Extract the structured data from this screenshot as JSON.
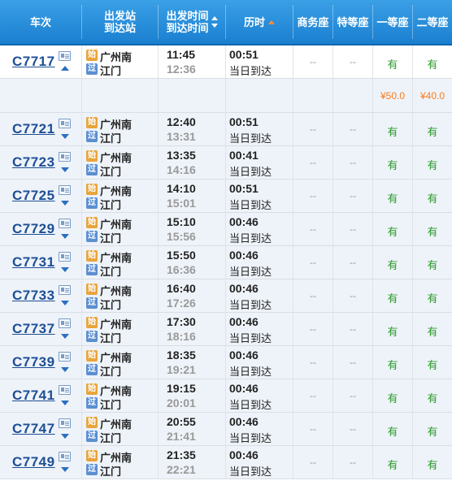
{
  "header": {
    "train": "车次",
    "station_top": "出发站",
    "station_bottom": "到达站",
    "time_top": "出发时间",
    "time_bottom": "到达时间",
    "duration": "历时",
    "business": "商务座",
    "special": "特等座",
    "first": "一等座",
    "second": "二等座"
  },
  "badges": {
    "start": "始",
    "pass": "过"
  },
  "price_row": {
    "first": "¥50.0",
    "second": "¥40.0"
  },
  "trains": [
    {
      "no": "C7717",
      "from": "广州南",
      "to": "江门",
      "dep": "11:45",
      "arr": "12:36",
      "dur": "00:51",
      "day": "当日到达",
      "business": "--",
      "special": "--",
      "first": "有",
      "second": "有"
    },
    {
      "no": "C7721",
      "from": "广州南",
      "to": "江门",
      "dep": "12:40",
      "arr": "13:31",
      "dur": "00:51",
      "day": "当日到达",
      "business": "--",
      "special": "--",
      "first": "有",
      "second": "有"
    },
    {
      "no": "C7723",
      "from": "广州南",
      "to": "江门",
      "dep": "13:35",
      "arr": "14:16",
      "dur": "00:41",
      "day": "当日到达",
      "business": "--",
      "special": "--",
      "first": "有",
      "second": "有"
    },
    {
      "no": "C7725",
      "from": "广州南",
      "to": "江门",
      "dep": "14:10",
      "arr": "15:01",
      "dur": "00:51",
      "day": "当日到达",
      "business": "--",
      "special": "--",
      "first": "有",
      "second": "有"
    },
    {
      "no": "C7729",
      "from": "广州南",
      "to": "江门",
      "dep": "15:10",
      "arr": "15:56",
      "dur": "00:46",
      "day": "当日到达",
      "business": "--",
      "special": "--",
      "first": "有",
      "second": "有"
    },
    {
      "no": "C7731",
      "from": "广州南",
      "to": "江门",
      "dep": "15:50",
      "arr": "16:36",
      "dur": "00:46",
      "day": "当日到达",
      "business": "--",
      "special": "--",
      "first": "有",
      "second": "有"
    },
    {
      "no": "C7733",
      "from": "广州南",
      "to": "江门",
      "dep": "16:40",
      "arr": "17:26",
      "dur": "00:46",
      "day": "当日到达",
      "business": "--",
      "special": "--",
      "first": "有",
      "second": "有"
    },
    {
      "no": "C7737",
      "from": "广州南",
      "to": "江门",
      "dep": "17:30",
      "arr": "18:16",
      "dur": "00:46",
      "day": "当日到达",
      "business": "--",
      "special": "--",
      "first": "有",
      "second": "有"
    },
    {
      "no": "C7739",
      "from": "广州南",
      "to": "江门",
      "dep": "18:35",
      "arr": "19:21",
      "dur": "00:46",
      "day": "当日到达",
      "business": "--",
      "special": "--",
      "first": "有",
      "second": "有"
    },
    {
      "no": "C7741",
      "from": "广州南",
      "to": "江门",
      "dep": "19:15",
      "arr": "20:01",
      "dur": "00:46",
      "day": "当日到达",
      "business": "--",
      "special": "--",
      "first": "有",
      "second": "有"
    },
    {
      "no": "C7747",
      "from": "广州南",
      "to": "江门",
      "dep": "20:55",
      "arr": "21:41",
      "dur": "00:46",
      "day": "当日到达",
      "business": "--",
      "special": "--",
      "first": "有",
      "second": "有"
    },
    {
      "no": "C7749",
      "from": "广州南",
      "to": "江门",
      "dep": "21:35",
      "arr": "22:21",
      "dur": "00:46",
      "day": "当日到达",
      "business": "--",
      "special": "--",
      "first": "有",
      "second": "有"
    }
  ]
}
